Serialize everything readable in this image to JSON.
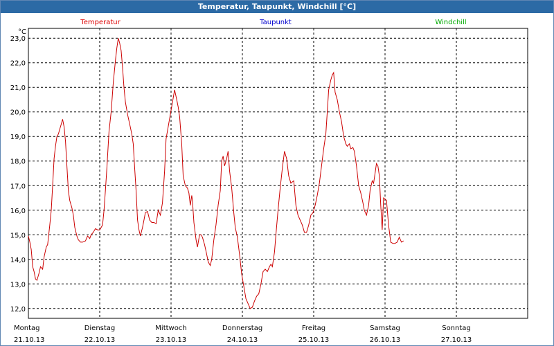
{
  "window": {
    "title": "Temperatur, Taupunkt, Windchill [°C]"
  },
  "chart_data": {
    "type": "line",
    "title": "Temperatur, Taupunkt, Windchill [°C]",
    "ylabel": "°C",
    "ylim": [
      11.6,
      23.4
    ],
    "xlim": [
      0,
      7
    ],
    "grid": true,
    "legend_placement": "top",
    "y_ticks": [
      "23,0",
      "22,0",
      "21,0",
      "20,0",
      "19,0",
      "18,0",
      "17,0",
      "16,0",
      "15,0",
      "14,0",
      "13,0",
      "12,0"
    ],
    "y_tick_values": [
      23,
      22,
      21,
      20,
      19,
      18,
      17,
      16,
      15,
      14,
      13,
      12
    ],
    "x_ticks": [
      {
        "pos": 0,
        "day": "Montag",
        "date": "21.10.13"
      },
      {
        "pos": 1,
        "day": "Dienstag",
        "date": "22.10.13"
      },
      {
        "pos": 2,
        "day": "Mittwoch",
        "date": "23.10.13"
      },
      {
        "pos": 3,
        "day": "Donnerstag",
        "date": "24.10.13"
      },
      {
        "pos": 4,
        "day": "Freitag",
        "date": "25.10.13"
      },
      {
        "pos": 5,
        "day": "Samstag",
        "date": "26.10.13"
      },
      {
        "pos": 6,
        "day": "Sonntag",
        "date": "27.10.13"
      }
    ],
    "legend": [
      {
        "name": "Temperatur",
        "color": "#dd0000"
      },
      {
        "name": "Taupunkt",
        "color": "#0000cc"
      },
      {
        "name": "Windchill",
        "color": "#00aa00"
      }
    ],
    "series": [
      {
        "name": "Temperatur",
        "color": "#cc0000",
        "points": [
          [
            0.0,
            14.95
          ],
          [
            0.02,
            14.7
          ],
          [
            0.04,
            14.4
          ],
          [
            0.06,
            13.7
          ],
          [
            0.08,
            13.5
          ],
          [
            0.1,
            13.2
          ],
          [
            0.12,
            13.15
          ],
          [
            0.15,
            13.45
          ],
          [
            0.17,
            13.7
          ],
          [
            0.2,
            13.6
          ],
          [
            0.22,
            14.1
          ],
          [
            0.25,
            14.5
          ],
          [
            0.27,
            14.6
          ],
          [
            0.3,
            15.4
          ],
          [
            0.32,
            16.0
          ],
          [
            0.34,
            17.0
          ],
          [
            0.36,
            18.1
          ],
          [
            0.38,
            18.6
          ],
          [
            0.4,
            19.0
          ],
          [
            0.42,
            19.1
          ],
          [
            0.44,
            19.3
          ],
          [
            0.46,
            19.5
          ],
          [
            0.48,
            19.7
          ],
          [
            0.5,
            19.4
          ],
          [
            0.52,
            18.8
          ],
          [
            0.54,
            17.8
          ],
          [
            0.56,
            16.8
          ],
          [
            0.58,
            16.4
          ],
          [
            0.61,
            16.1
          ],
          [
            0.63,
            15.8
          ],
          [
            0.65,
            15.3
          ],
          [
            0.68,
            14.95
          ],
          [
            0.7,
            14.8
          ],
          [
            0.73,
            14.7
          ],
          [
            0.76,
            14.7
          ],
          [
            0.8,
            14.75
          ],
          [
            0.83,
            14.95
          ],
          [
            0.86,
            14.85
          ],
          [
            0.88,
            15.0
          ],
          [
            0.91,
            15.1
          ],
          [
            0.94,
            15.25
          ],
          [
            0.97,
            15.2
          ],
          [
            1.0,
            15.2
          ],
          [
            1.02,
            15.3
          ],
          [
            1.04,
            15.4
          ],
          [
            1.06,
            16.0
          ],
          [
            1.08,
            16.8
          ],
          [
            1.1,
            17.7
          ],
          [
            1.13,
            19.2
          ],
          [
            1.16,
            20.0
          ],
          [
            1.19,
            21.2
          ],
          [
            1.22,
            22.1
          ],
          [
            1.24,
            22.6
          ],
          [
            1.26,
            23.0
          ],
          [
            1.28,
            22.8
          ],
          [
            1.3,
            22.5
          ],
          [
            1.32,
            21.8
          ],
          [
            1.34,
            21.0
          ],
          [
            1.36,
            20.4
          ],
          [
            1.39,
            19.9
          ],
          [
            1.42,
            19.5
          ],
          [
            1.45,
            19.1
          ],
          [
            1.47,
            18.7
          ],
          [
            1.49,
            17.7
          ],
          [
            1.51,
            16.8
          ],
          [
            1.53,
            15.6
          ],
          [
            1.55,
            15.2
          ],
          [
            1.57,
            14.95
          ],
          [
            1.6,
            15.3
          ],
          [
            1.62,
            15.6
          ],
          [
            1.64,
            15.9
          ],
          [
            1.67,
            15.95
          ],
          [
            1.7,
            15.6
          ],
          [
            1.73,
            15.5
          ],
          [
            1.76,
            15.5
          ],
          [
            1.79,
            15.45
          ],
          [
            1.82,
            16.0
          ],
          [
            1.85,
            15.8
          ],
          [
            1.88,
            16.3
          ],
          [
            1.91,
            17.6
          ],
          [
            1.93,
            18.9
          ],
          [
            1.96,
            19.4
          ],
          [
            1.99,
            19.9
          ],
          [
            2.02,
            20.4
          ],
          [
            2.05,
            20.9
          ],
          [
            2.08,
            20.5
          ],
          [
            2.1,
            20.2
          ],
          [
            2.12,
            19.8
          ],
          [
            2.15,
            18.7
          ],
          [
            2.17,
            17.4
          ],
          [
            2.2,
            17.0
          ],
          [
            2.23,
            16.9
          ],
          [
            2.25,
            16.7
          ],
          [
            2.27,
            16.2
          ],
          [
            2.29,
            16.6
          ],
          [
            2.3,
            16.4
          ],
          [
            2.32,
            15.5
          ],
          [
            2.35,
            14.8
          ],
          [
            2.37,
            14.5
          ],
          [
            2.4,
            15.0
          ],
          [
            2.42,
            15.0
          ],
          [
            2.44,
            14.9
          ],
          [
            2.47,
            14.6
          ],
          [
            2.5,
            14.2
          ],
          [
            2.52,
            13.9
          ],
          [
            2.55,
            13.75
          ],
          [
            2.57,
            14.0
          ],
          [
            2.6,
            14.8
          ],
          [
            2.63,
            15.4
          ],
          [
            2.66,
            16.2
          ],
          [
            2.69,
            16.8
          ],
          [
            2.71,
            18.0
          ],
          [
            2.73,
            18.2
          ],
          [
            2.75,
            17.8
          ],
          [
            2.78,
            18.1
          ],
          [
            2.8,
            18.4
          ],
          [
            2.82,
            17.6
          ],
          [
            2.85,
            16.9
          ],
          [
            2.88,
            15.9
          ],
          [
            2.9,
            15.3
          ],
          [
            2.93,
            14.9
          ],
          [
            2.96,
            14.2
          ],
          [
            2.99,
            13.4
          ],
          [
            3.02,
            12.9
          ],
          [
            3.05,
            12.4
          ],
          [
            3.08,
            12.2
          ],
          [
            3.11,
            12.0
          ],
          [
            3.14,
            12.05
          ],
          [
            3.17,
            12.3
          ],
          [
            3.2,
            12.5
          ],
          [
            3.23,
            12.6
          ],
          [
            3.26,
            13.0
          ],
          [
            3.29,
            13.5
          ],
          [
            3.32,
            13.6
          ],
          [
            3.35,
            13.5
          ],
          [
            3.38,
            13.7
          ],
          [
            3.4,
            13.8
          ],
          [
            3.42,
            13.7
          ],
          [
            3.45,
            14.3
          ],
          [
            3.47,
            15.0
          ],
          [
            3.5,
            16.0
          ],
          [
            3.53,
            16.9
          ],
          [
            3.56,
            17.7
          ],
          [
            3.59,
            18.4
          ],
          [
            3.62,
            18.1
          ],
          [
            3.65,
            17.4
          ],
          [
            3.68,
            17.1
          ],
          [
            3.72,
            17.2
          ],
          [
            3.75,
            16.2
          ],
          [
            3.78,
            15.8
          ],
          [
            3.81,
            15.6
          ],
          [
            3.84,
            15.4
          ],
          [
            3.87,
            15.1
          ],
          [
            3.9,
            15.1
          ],
          [
            3.93,
            15.4
          ],
          [
            3.96,
            15.8
          ],
          [
            3.99,
            15.9
          ],
          [
            4.02,
            16.2
          ],
          [
            4.05,
            16.6
          ],
          [
            4.08,
            17.1
          ],
          [
            4.11,
            17.8
          ],
          [
            4.14,
            18.5
          ],
          [
            4.17,
            19.1
          ],
          [
            4.19,
            20.0
          ],
          [
            4.21,
            20.9
          ],
          [
            4.24,
            21.3
          ],
          [
            4.26,
            21.5
          ],
          [
            4.28,
            21.6
          ],
          [
            4.3,
            20.8
          ],
          [
            4.33,
            20.5
          ],
          [
            4.36,
            20.0
          ],
          [
            4.39,
            19.6
          ],
          [
            4.42,
            19.0
          ],
          [
            4.45,
            18.7
          ],
          [
            4.47,
            18.6
          ],
          [
            4.5,
            18.7
          ],
          [
            4.52,
            18.5
          ],
          [
            4.55,
            18.55
          ],
          [
            4.57,
            18.4
          ],
          [
            4.6,
            17.8
          ],
          [
            4.63,
            17.0
          ],
          [
            4.66,
            16.7
          ],
          [
            4.69,
            16.3
          ],
          [
            4.71,
            16.0
          ],
          [
            4.74,
            15.8
          ],
          [
            4.77,
            16.2
          ],
          [
            4.79,
            16.8
          ],
          [
            4.82,
            17.2
          ],
          [
            4.84,
            17.1
          ],
          [
            4.86,
            17.5
          ],
          [
            4.88,
            17.9
          ],
          [
            4.9,
            17.8
          ],
          [
            4.92,
            17.4
          ],
          [
            4.94,
            16.2
          ],
          [
            4.96,
            15.2
          ],
          [
            4.98,
            16.5
          ],
          [
            5.0,
            16.45
          ],
          [
            5.02,
            16.4
          ],
          [
            5.05,
            15.4
          ],
          [
            5.08,
            14.7
          ],
          [
            5.11,
            14.65
          ],
          [
            5.14,
            14.65
          ],
          [
            5.17,
            14.7
          ],
          [
            5.2,
            14.9
          ],
          [
            5.23,
            14.7
          ],
          [
            5.26,
            14.75
          ]
        ]
      }
    ]
  }
}
